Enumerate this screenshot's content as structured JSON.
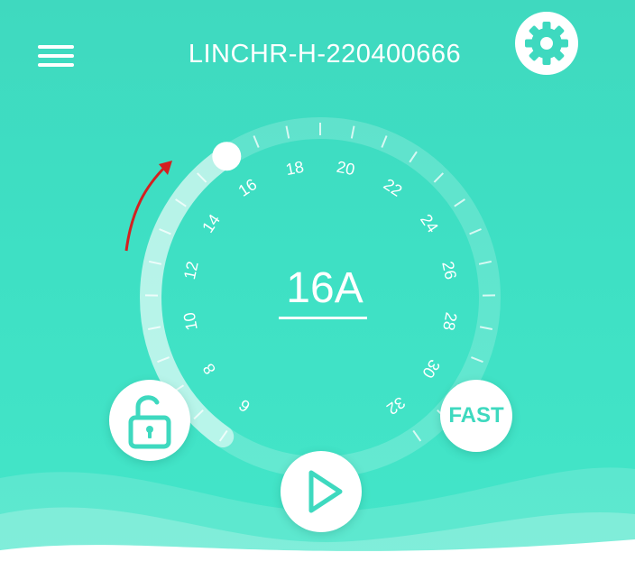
{
  "header": {
    "device_name": "LINCHR-H-220400666",
    "menu_icon": "hamburger-menu-icon",
    "settings_icon": "gear-icon"
  },
  "dial": {
    "ticks": [
      "6",
      "8",
      "10",
      "12",
      "14",
      "16",
      "18",
      "20",
      "22",
      "24",
      "26",
      "28",
      "30",
      "32"
    ],
    "current_display": "16A",
    "setting_value": 16,
    "min": 6,
    "max": 32
  },
  "controls": {
    "lock_icon": "unlocked-padlock-icon",
    "fast_label": "FAST",
    "play_icon": "play-icon"
  },
  "colors": {
    "accent": "#3ed9bf",
    "text": "#ffffff",
    "annotation_arrow": "#d42020"
  }
}
